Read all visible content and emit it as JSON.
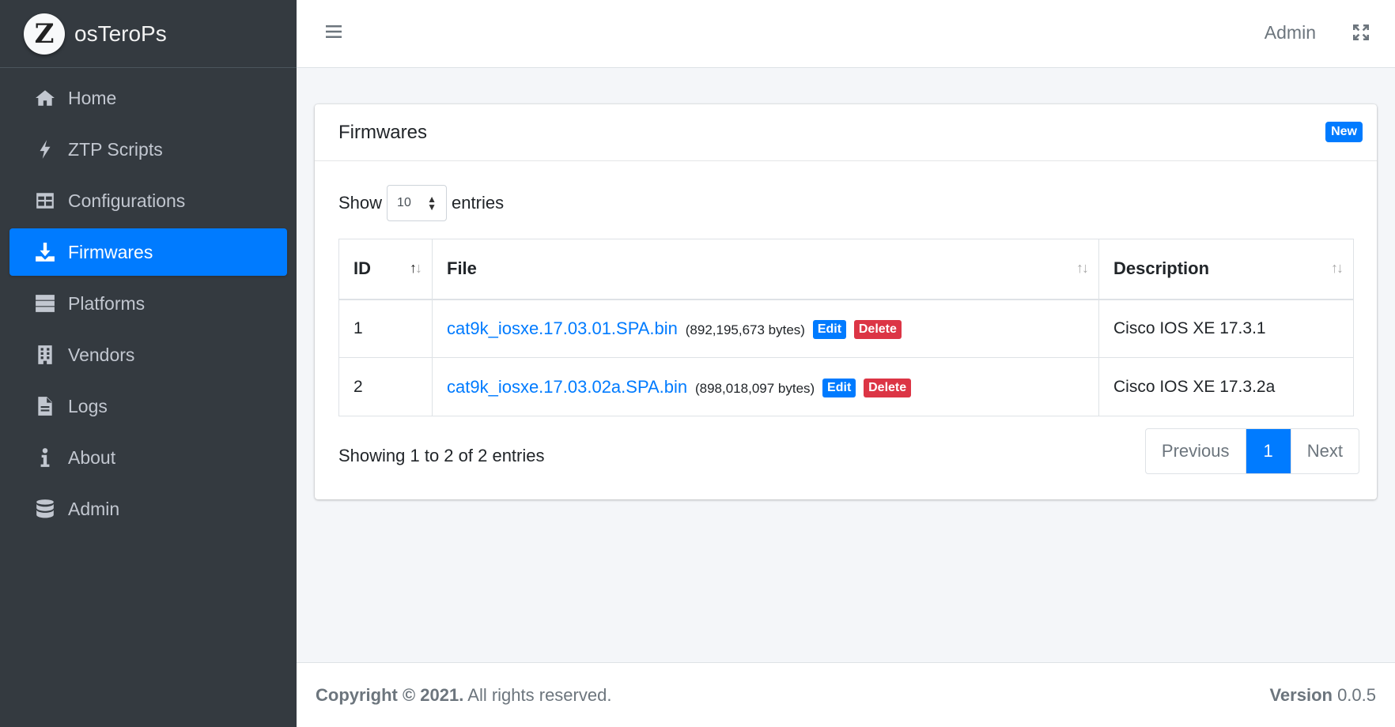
{
  "brand": {
    "logo_letter": "Z",
    "name": "osTeroPs"
  },
  "sidebar": {
    "items": [
      {
        "label": "Home",
        "icon": "home-icon",
        "active": false
      },
      {
        "label": "ZTP Scripts",
        "icon": "bolt-icon",
        "active": false
      },
      {
        "label": "Configurations",
        "icon": "table-icon",
        "active": false
      },
      {
        "label": "Firmwares",
        "icon": "download-icon",
        "active": true
      },
      {
        "label": "Platforms",
        "icon": "server-icon",
        "active": false
      },
      {
        "label": "Vendors",
        "icon": "building-icon",
        "active": false
      },
      {
        "label": "Logs",
        "icon": "file-icon",
        "active": false
      },
      {
        "label": "About",
        "icon": "info-icon",
        "active": false
      },
      {
        "label": "Admin",
        "icon": "database-icon",
        "active": false
      }
    ]
  },
  "header": {
    "user": "Admin"
  },
  "card": {
    "title": "Firmwares",
    "new_label": "New",
    "length": {
      "show": "Show",
      "value": "10",
      "entries": "entries"
    },
    "columns": [
      "ID",
      "File",
      "Description"
    ],
    "rows": [
      {
        "id": "1",
        "file": "cat9k_iosxe.17.03.01.SPA.bin",
        "size": "(892,195,673 bytes)",
        "edit": "Edit",
        "delete": "Delete",
        "description": "Cisco IOS XE 17.3.1"
      },
      {
        "id": "2",
        "file": "cat9k_iosxe.17.03.02a.SPA.bin",
        "size": "(898,018,097 bytes)",
        "edit": "Edit",
        "delete": "Delete",
        "description": "Cisco IOS XE 17.3.2a"
      }
    ],
    "info": "Showing 1 to 2 of 2 entries",
    "pagination": {
      "previous": "Previous",
      "current": "1",
      "next": "Next"
    }
  },
  "footer": {
    "copyright_bold": "Copyright © 2021.",
    "copyright_rest": " All rights reserved.",
    "version_label": "Version",
    "version_value": " 0.0.5"
  },
  "colors": {
    "sidebar": "#343a40",
    "accent": "#007bff",
    "danger": "#dc3545"
  }
}
